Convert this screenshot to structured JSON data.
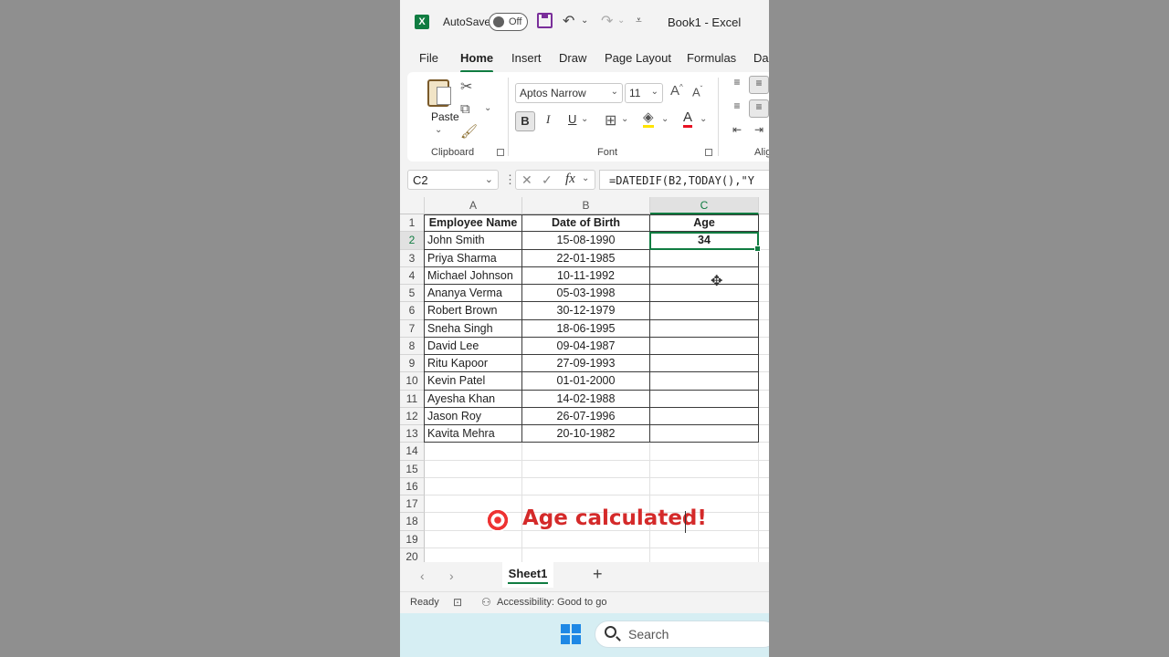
{
  "titlebar": {
    "autosave_label": "AutoSave",
    "autosave_state": "Off",
    "book_title": "Book1  -  Excel"
  },
  "tabs": [
    "File",
    "Home",
    "Insert",
    "Draw",
    "Page Layout",
    "Formulas",
    "Da"
  ],
  "ribbon": {
    "paste_label": "Paste",
    "clipboard_label": "Clipboard",
    "font_name": "Aptos Narrow",
    "font_size": "11",
    "font_label": "Font",
    "align_label": "Alig",
    "bold": "B",
    "italic": "I",
    "underline": "U"
  },
  "formula_bar": {
    "name_box": "C2",
    "fx": "fx",
    "formula": "=DATEDIF(B2,TODAY(),\"Y"
  },
  "grid": {
    "columns": [
      "A",
      "B",
      "C"
    ],
    "rows": [
      {
        "num": "1",
        "a": "Employee Name",
        "b": "Date of Birth",
        "c": "Age"
      },
      {
        "num": "2",
        "a": "John Smith",
        "b": "15-08-1990",
        "c": "34"
      },
      {
        "num": "3",
        "a": "Priya Sharma",
        "b": "22-01-1985",
        "c": ""
      },
      {
        "num": "4",
        "a": "Michael Johnson",
        "b": "10-11-1992",
        "c": ""
      },
      {
        "num": "5",
        "a": "Ananya Verma",
        "b": "05-03-1998",
        "c": ""
      },
      {
        "num": "6",
        "a": "Robert Brown",
        "b": "30-12-1979",
        "c": ""
      },
      {
        "num": "7",
        "a": "Sneha Singh",
        "b": "18-06-1995",
        "c": ""
      },
      {
        "num": "8",
        "a": "David Lee",
        "b": "09-04-1987",
        "c": ""
      },
      {
        "num": "9",
        "a": "Ritu Kapoor",
        "b": "27-09-1993",
        "c": ""
      },
      {
        "num": "10",
        "a": "Kevin Patel",
        "b": "01-01-2000",
        "c": ""
      },
      {
        "num": "11",
        "a": "Ayesha Khan",
        "b": "14-02-1988",
        "c": ""
      },
      {
        "num": "12",
        "a": "Jason Roy",
        "b": "26-07-1996",
        "c": ""
      },
      {
        "num": "13",
        "a": "Kavita Mehra",
        "b": "20-10-1982",
        "c": ""
      },
      {
        "num": "14",
        "a": "",
        "b": "",
        "c": ""
      },
      {
        "num": "15",
        "a": "",
        "b": "",
        "c": ""
      },
      {
        "num": "16",
        "a": "",
        "b": "",
        "c": ""
      },
      {
        "num": "17",
        "a": "",
        "b": "",
        "c": ""
      },
      {
        "num": "18",
        "a": "",
        "b": "",
        "c": ""
      },
      {
        "num": "19",
        "a": "",
        "b": "",
        "c": ""
      },
      {
        "num": "20",
        "a": "",
        "b": "",
        "c": ""
      }
    ]
  },
  "caption": "Age calculated!",
  "sheets": {
    "active": "Sheet1",
    "add": "+"
  },
  "status": {
    "ready": "Ready",
    "accessibility": "Accessibility: Good to go"
  },
  "taskbar": {
    "search": "Search"
  },
  "colors": {
    "excel_green": "#107c41",
    "caption_red": "#d42a2a"
  }
}
